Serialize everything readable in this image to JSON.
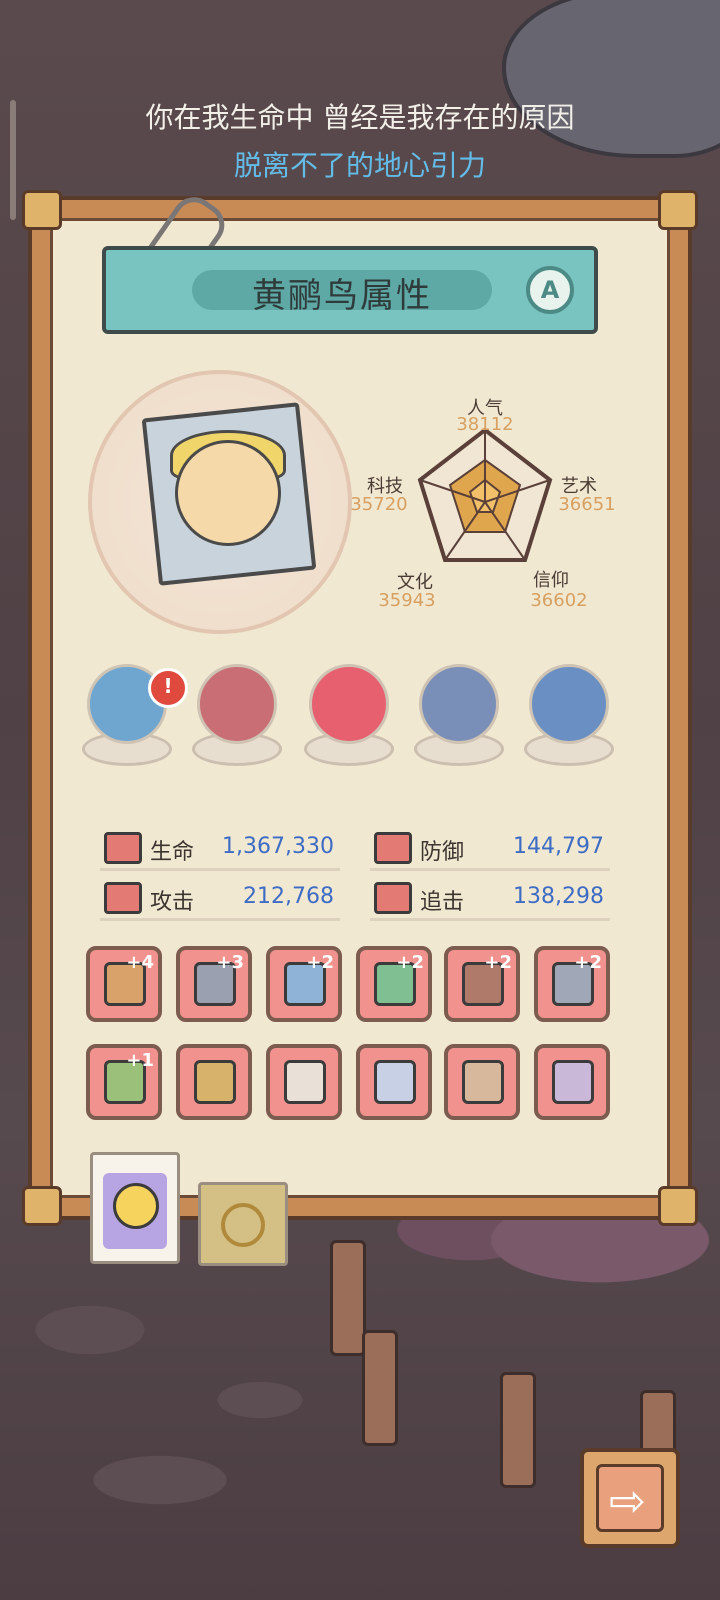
{
  "lyrics": {
    "line1": "你在我生命中 曾经是我存在的原因",
    "line2": "脱离不了的地心引力"
  },
  "panel": {
    "title": "黄鹂鸟属性",
    "grade": "A"
  },
  "radar": {
    "stats": [
      {
        "label": "人气",
        "value": "38112"
      },
      {
        "label": "艺术",
        "value": "36651"
      },
      {
        "label": "信仰",
        "value": "36602"
      },
      {
        "label": "文化",
        "value": "35943"
      },
      {
        "label": "科技",
        "value": "35720"
      }
    ]
  },
  "artifacts": [
    {
      "name": "urchin-artifact",
      "color": "#6fa6d0",
      "alert": "!"
    },
    {
      "name": "beast-skull-artifact",
      "color": "#c86e74"
    },
    {
      "name": "shell-artifact",
      "color": "#e66070"
    },
    {
      "name": "compass-artifact",
      "color": "#7a8fb8"
    },
    {
      "name": "gem-box-artifact",
      "color": "#6a8fc2"
    }
  ],
  "combat_stats": [
    {
      "label": "生命",
      "value": "1,367,330"
    },
    {
      "label": "防御",
      "value": "144,797"
    },
    {
      "label": "攻击",
      "value": "212,768"
    },
    {
      "label": "追击",
      "value": "138,298"
    }
  ],
  "equipment": [
    {
      "name": "crossbow-equip",
      "plus": "+4",
      "color": "#d9a26a"
    },
    {
      "name": "rocket-sword-equip",
      "plus": "+3",
      "color": "#9aa0b0"
    },
    {
      "name": "dagger-equip",
      "plus": "+2",
      "color": "#8fb3d6"
    },
    {
      "name": "serpent-staff-equip",
      "plus": "+2",
      "color": "#7fbf92"
    },
    {
      "name": "tablet-equip",
      "plus": "+2",
      "color": "#b07a6a"
    },
    {
      "name": "short-sword-equip",
      "plus": "+2",
      "color": "#a0a8b8"
    },
    {
      "name": "hammer-equip",
      "plus": "+1",
      "color": "#9ac07a"
    },
    {
      "name": "ring-equip",
      "plus": "",
      "color": "#d6b26a"
    },
    {
      "name": "armor-equip",
      "plus": "",
      "color": "#e9e0d8"
    },
    {
      "name": "robe-equip",
      "plus": "",
      "color": "#c8d0e6"
    },
    {
      "name": "pants-equip",
      "plus": "",
      "color": "#d8b89c"
    },
    {
      "name": "bracer-equip",
      "plus": "",
      "color": "#c9b8d8"
    }
  ],
  "next_arrow": "⇨"
}
